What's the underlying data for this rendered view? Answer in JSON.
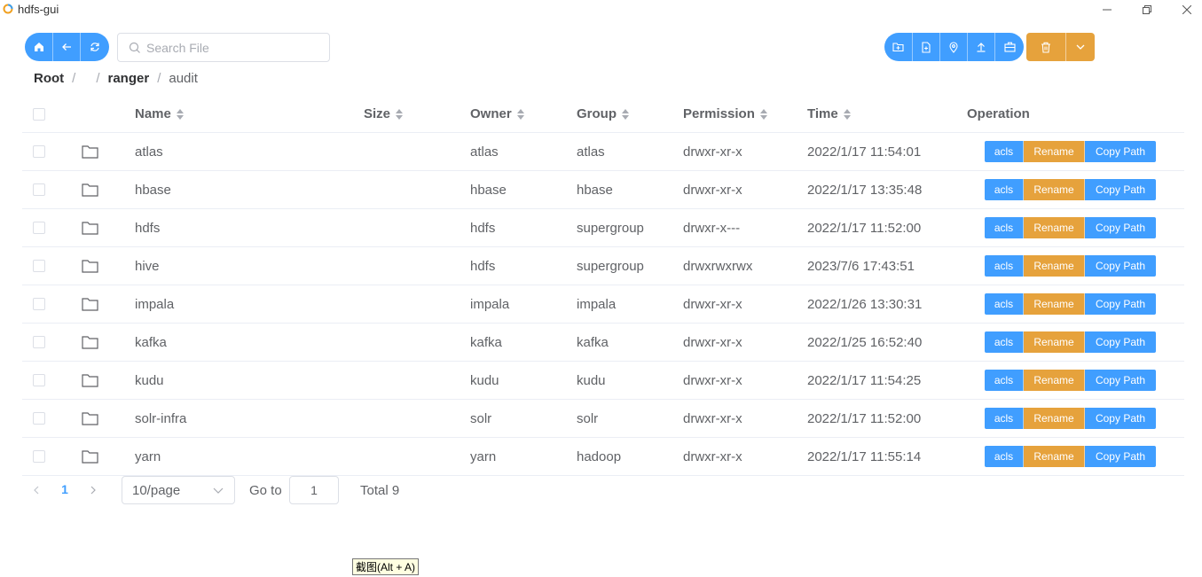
{
  "window": {
    "title": "hdfs-gui",
    "icon": "app-logo-icon",
    "controls": [
      "minimize-icon",
      "maximize-icon",
      "close-icon"
    ]
  },
  "nav": {
    "buttons": [
      "home-icon",
      "back-arrow-icon",
      "refresh-icon"
    ]
  },
  "search": {
    "placeholder": "Search File",
    "value": ""
  },
  "toolbar": {
    "buttons": [
      "new-folder-icon",
      "new-file-icon",
      "location-icon",
      "upload-icon",
      "briefcase-icon"
    ],
    "delete_icon": "trash-icon",
    "dropdown_icon": "chevron-down-icon"
  },
  "breadcrumb": {
    "root": "Root",
    "separator": "/",
    "items": [
      "",
      "ranger",
      "audit"
    ]
  },
  "table": {
    "columns": {
      "name": "Name",
      "size": "Size",
      "owner": "Owner",
      "group": "Group",
      "permission": "Permission",
      "time": "Time",
      "operation": "Operation"
    },
    "action_labels": {
      "acls": "acls",
      "rename": "Rename",
      "copy_path": "Copy Path"
    },
    "rows": [
      {
        "name": "atlas",
        "size": "",
        "owner": "atlas",
        "group": "atlas",
        "permission": "drwxr-xr-x",
        "time": "2022/1/17 11:54:01"
      },
      {
        "name": "hbase",
        "size": "",
        "owner": "hbase",
        "group": "hbase",
        "permission": "drwxr-xr-x",
        "time": "2022/1/17 13:35:48"
      },
      {
        "name": "hdfs",
        "size": "",
        "owner": "hdfs",
        "group": "supergroup",
        "permission": "drwxr-x---",
        "time": "2022/1/17 11:52:00"
      },
      {
        "name": "hive",
        "size": "",
        "owner": "hdfs",
        "group": "supergroup",
        "permission": "drwxrwxrwx",
        "time": "2023/7/6 17:43:51"
      },
      {
        "name": "impala",
        "size": "",
        "owner": "impala",
        "group": "impala",
        "permission": "drwxr-xr-x",
        "time": "2022/1/26 13:30:31"
      },
      {
        "name": "kafka",
        "size": "",
        "owner": "kafka",
        "group": "kafka",
        "permission": "drwxr-xr-x",
        "time": "2022/1/25 16:52:40"
      },
      {
        "name": "kudu",
        "size": "",
        "owner": "kudu",
        "group": "kudu",
        "permission": "drwxr-xr-x",
        "time": "2022/1/17 11:54:25"
      },
      {
        "name": "solr-infra",
        "size": "",
        "owner": "solr",
        "group": "solr",
        "permission": "drwxr-xr-x",
        "time": "2022/1/17 11:52:00"
      },
      {
        "name": "yarn",
        "size": "",
        "owner": "yarn",
        "group": "hadoop",
        "permission": "drwxr-xr-x",
        "time": "2022/1/17 11:55:14"
      }
    ]
  },
  "pagination": {
    "current_page": "1",
    "page_size": "10/page",
    "goto_label": "Go to",
    "goto_value": "1",
    "total": "Total 9"
  },
  "tooltip": {
    "text": "截图(Alt + A)"
  },
  "colors": {
    "primary": "#409eff",
    "warning": "#e6a23c",
    "text": "#606266",
    "header_text": "#909399",
    "border": "#ebeef5"
  }
}
